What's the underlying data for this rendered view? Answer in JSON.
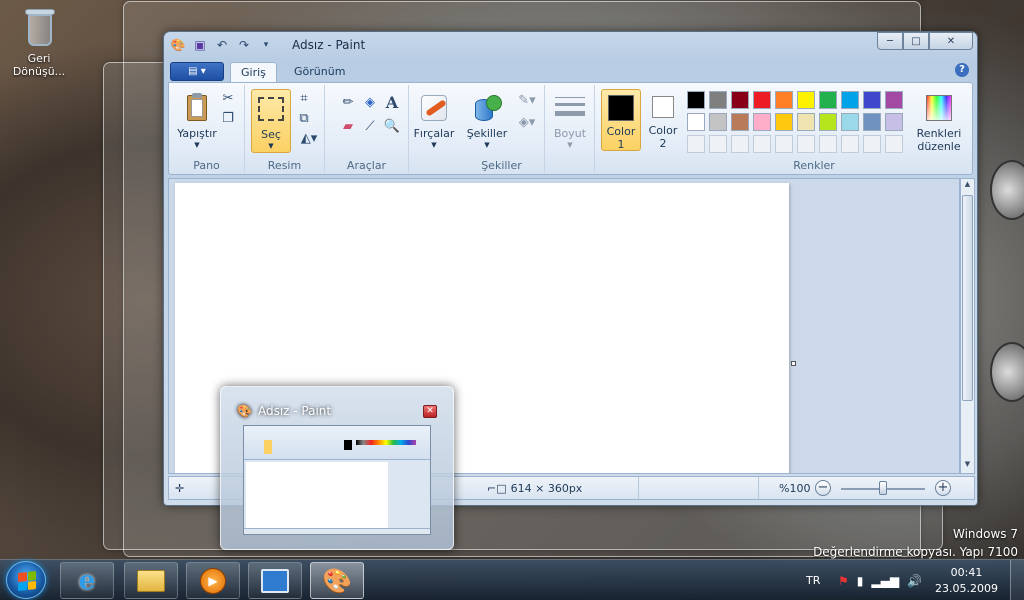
{
  "desktop": {
    "recycle_bin_label": "Geri Dönüşü...",
    "watermark_line1": "Windows 7",
    "watermark_line2": "Değerlendirme kopyası. Yapı 7100"
  },
  "window": {
    "title": "Adsız - Paint",
    "controls": {
      "minimize": "─",
      "maximize": "□",
      "close": "✕"
    }
  },
  "ribbon_tabs": {
    "app_menu": "▤ ▾",
    "tabs": [
      {
        "label": "Giriş",
        "active": true
      },
      {
        "label": "Görünüm",
        "active": false
      }
    ],
    "help": "?"
  },
  "ribbon": {
    "pano": {
      "paste_label": "Yapıştır",
      "group_label": "Pano"
    },
    "resim": {
      "select_label": "Seç",
      "group_label": "Resim"
    },
    "araclar": {
      "group_label": "Araçlar"
    },
    "sekiller": {
      "brushes_label": "Fırçalar",
      "shapes_label": "Şekiller",
      "group_label": "Şekiller"
    },
    "boyut": {
      "label": "Boyut"
    },
    "colors": {
      "color1_label": "Color 1",
      "color1_line1": "Color",
      "color1_line2": "1",
      "color2_line1": "Color",
      "color2_line2": "2",
      "edit_line1": "Renkleri",
      "edit_line2": "düzenle",
      "group_label": "Renkler",
      "color1": "#000000",
      "color2": "#ffffff",
      "palette_row1": [
        "#000000",
        "#7f7f7f",
        "#880015",
        "#ed1c24",
        "#ff7f27",
        "#fff200",
        "#22b14c",
        "#00a2e8",
        "#3f48cc",
        "#a349a4"
      ],
      "palette_row2": [
        "#ffffff",
        "#c3c3c3",
        "#b97a57",
        "#ffaec9",
        "#ffc90e",
        "#efe4b0",
        "#b5e61d",
        "#99d9ea",
        "#7092be",
        "#c8bfe7"
      ]
    }
  },
  "status": {
    "dimensions": "614 × 360px",
    "zoom": "%100"
  },
  "thumbnail": {
    "title": "Adsız - Paint",
    "close": "✕"
  },
  "taskbar": {
    "language": "TR",
    "time": "00:41",
    "date": "23.05.2009"
  }
}
